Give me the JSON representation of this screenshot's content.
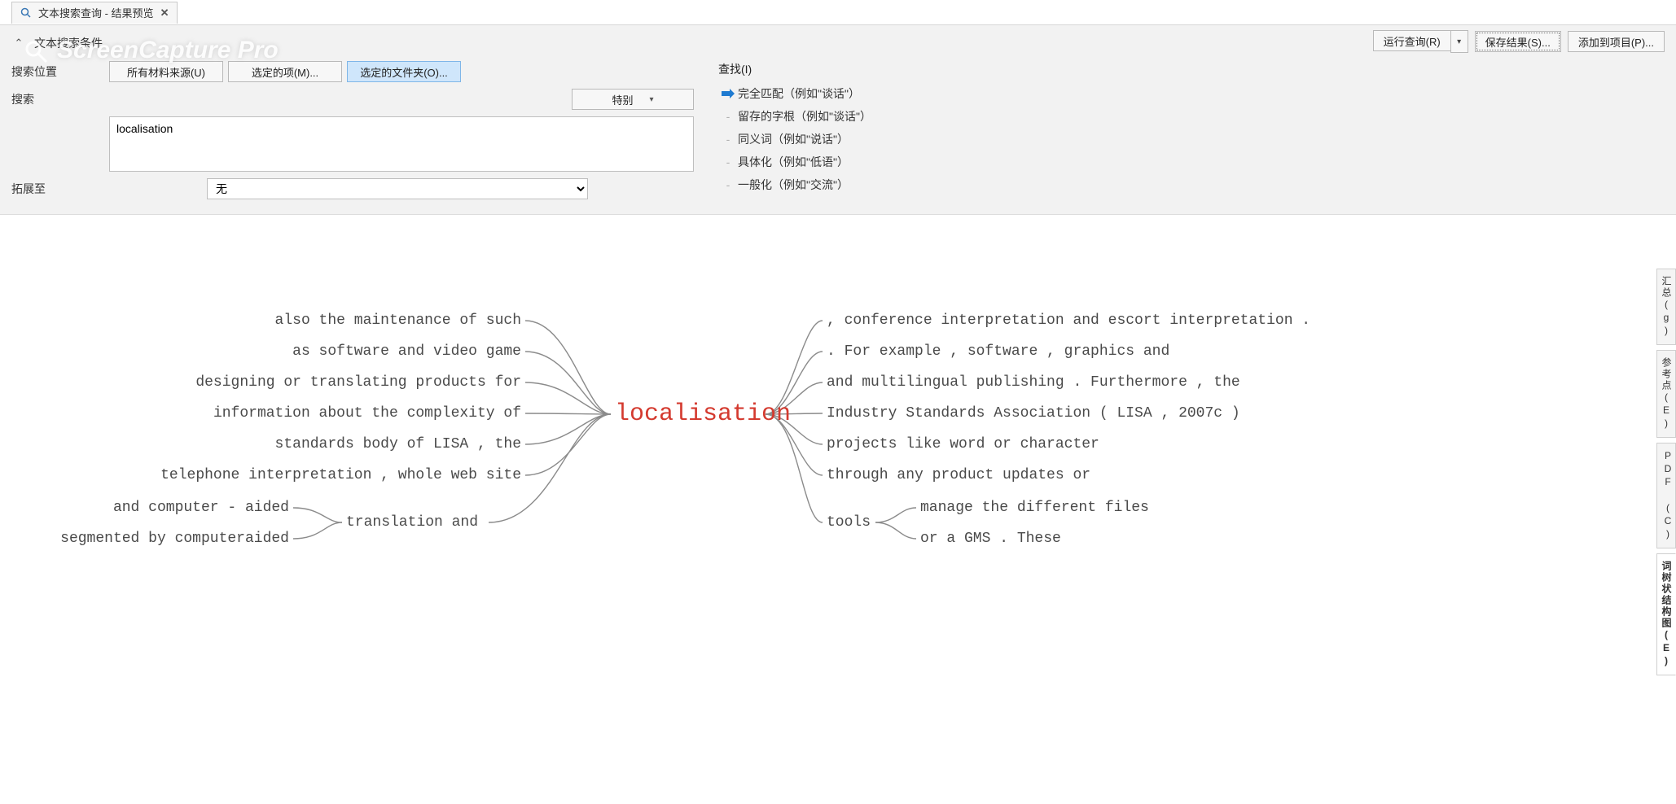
{
  "watermark": "ScreenCapture Pro",
  "tab": {
    "title": "文本搜索查询 - 结果预览"
  },
  "panel": {
    "title": "文本搜索条件",
    "actions": {
      "run": "运行查询(R)",
      "save": "保存结果(S)...",
      "add": "添加到项目(P)..."
    },
    "labels": {
      "searchIn": "搜索位置",
      "search": "搜索",
      "expand": "拓展至",
      "find": "查找(I)"
    },
    "sourceButtons": {
      "all": "所有材料来源(U)",
      "selectedItems": "选定的项(M)...",
      "selectedFolders": "选定的文件夹(O)..."
    },
    "special": "特别",
    "searchValue": "localisation",
    "expandValue": "无",
    "findOptions": [
      "完全匹配（例如\"谈话\"）",
      "留存的字根（例如\"谈话\"）",
      "同义词（例如\"说话\"）",
      "具体化（例如\"低语\"）",
      "一般化（例如\"交流\"）"
    ]
  },
  "sideTabs": [
    "汇总(g)",
    "参考点(E)",
    "PDF (C)",
    "词树状结构图(E)"
  ],
  "tree": {
    "center": "localisation",
    "left": [
      "also the maintenance of such",
      "as software and video game",
      "designing or translating products for",
      "information about the complexity of",
      "standards body of LISA , the",
      "telephone interpretation , whole web site"
    ],
    "leftGroupLabel": "translation and",
    "leftGroupItems": [
      "and computer - aided",
      "segmented by computeraided"
    ],
    "right": [
      ", conference interpretation and escort interpretation .",
      ". For example , software , graphics and",
      "and multilingual publishing . Furthermore , the",
      "Industry Standards Association ( LISA , 2007c )",
      "projects like word or character",
      "through any product updates or"
    ],
    "rightGroupLabel": "tools",
    "rightGroupItems": [
      "manage the different files",
      "or a GMS . These"
    ]
  }
}
